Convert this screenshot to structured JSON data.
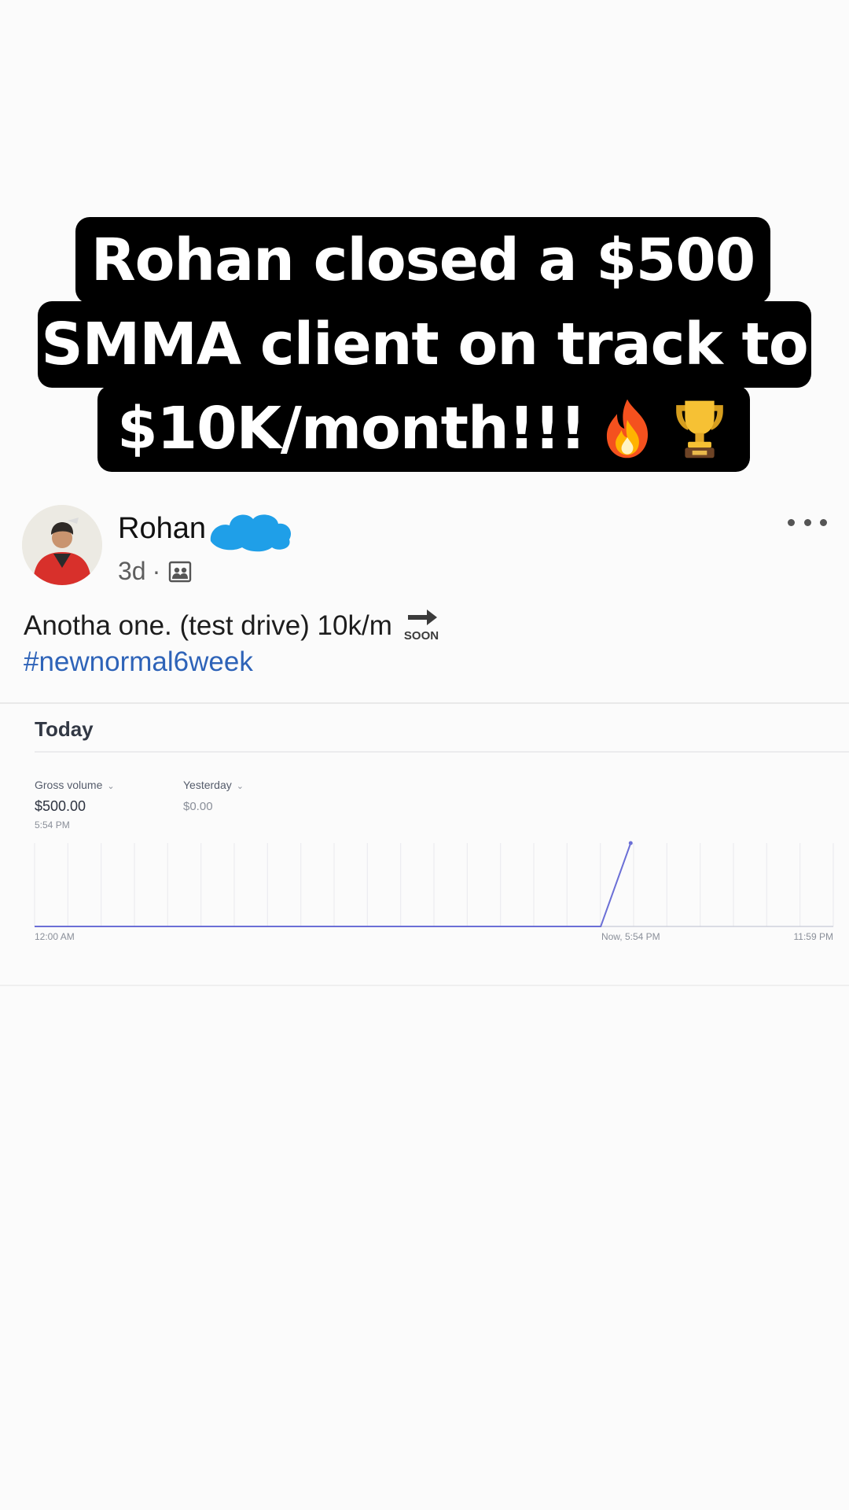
{
  "caption": {
    "line1": "Rohan closed a $500",
    "line2": "SMMA client on track to",
    "line3": "$10K/month!!!",
    "emojis": [
      "fire-emoji",
      "trophy-emoji"
    ]
  },
  "post": {
    "author": "Rohan",
    "age": "3d",
    "separator": "·",
    "audience_icon": "contacts-icon",
    "text": "Anotha one. (test drive) 10k/m",
    "text_emoji": "soon-arrow-emoji",
    "soon_label": "SOON",
    "hashtag": "#newnormal6week",
    "menu_icon": "more-dots-icon"
  },
  "dashboard": {
    "title": "Today",
    "gross_label": "Gross volume",
    "gross_value": "$500.00",
    "gross_time": "5:54 PM",
    "compare_label": "Yesterday",
    "compare_value": "$0.00",
    "line_color": "#6b6fd6",
    "grid_color": "#ececf0"
  },
  "chart_data": {
    "type": "line",
    "title": "",
    "xlabel": "",
    "ylabel": "",
    "x_tick_labels": [
      "12:00 AM",
      "Now, 5:54 PM",
      "11:59 PM"
    ],
    "xlim": [
      "12:00 AM",
      "11:59 PM"
    ],
    "ylim": [
      0,
      500
    ],
    "grid": true,
    "series": [
      {
        "x": [
          "12:00 AM",
          "4:00 PM",
          "5:00 PM",
          "5:54 PM"
        ],
        "x_hours": [
          0,
          16,
          17,
          17.9
        ],
        "y": [
          0,
          0,
          0,
          500
        ]
      }
    ]
  }
}
